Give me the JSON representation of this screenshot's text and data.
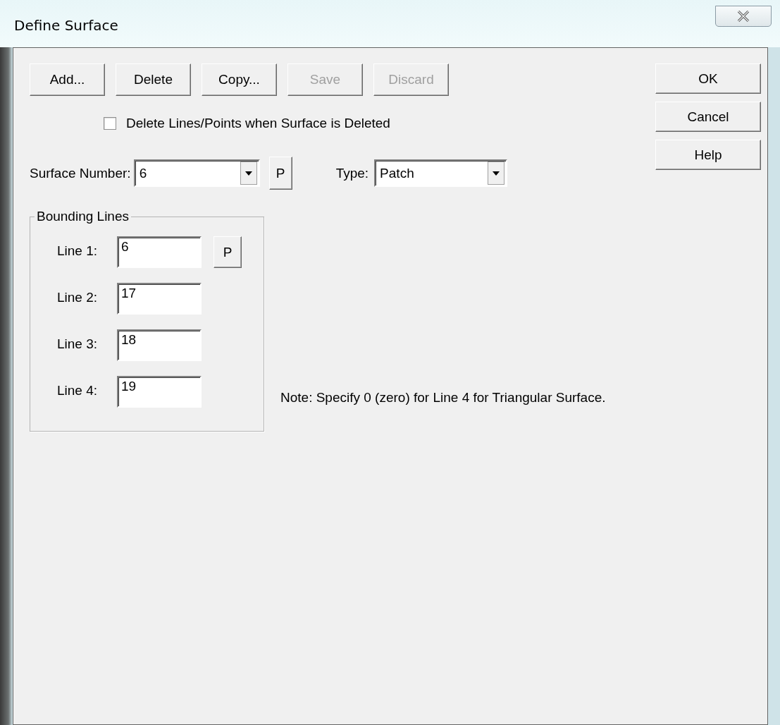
{
  "window": {
    "title": "Define Surface"
  },
  "toolbar_buttons": [
    {
      "label": "Add...",
      "disabled": false
    },
    {
      "label": "Delete",
      "disabled": false
    },
    {
      "label": "Copy...",
      "disabled": false
    },
    {
      "label": "Save",
      "disabled": true
    },
    {
      "label": "Discard",
      "disabled": true
    }
  ],
  "delete_option": {
    "label": "Delete Lines/Points when Surface is Deleted",
    "checked": false
  },
  "surface_number": {
    "label": "Surface Number:",
    "value": "6",
    "pick_button": "P"
  },
  "type": {
    "label": "Type:",
    "value": "Patch"
  },
  "bounding_lines": {
    "title": "Bounding Lines",
    "lines": [
      {
        "label": "Line 1:",
        "value": "6",
        "pick_button": "P"
      },
      {
        "label": "Line 2:",
        "value": "17"
      },
      {
        "label": "Line 3:",
        "value": "18"
      },
      {
        "label": "Line 4:",
        "value": "19"
      }
    ]
  },
  "note": "Note: Specify 0 (zero) for Line 4 for Triangular Surface.",
  "side_buttons": [
    {
      "label": "OK"
    },
    {
      "label": "Cancel"
    },
    {
      "label": "Help"
    }
  ]
}
